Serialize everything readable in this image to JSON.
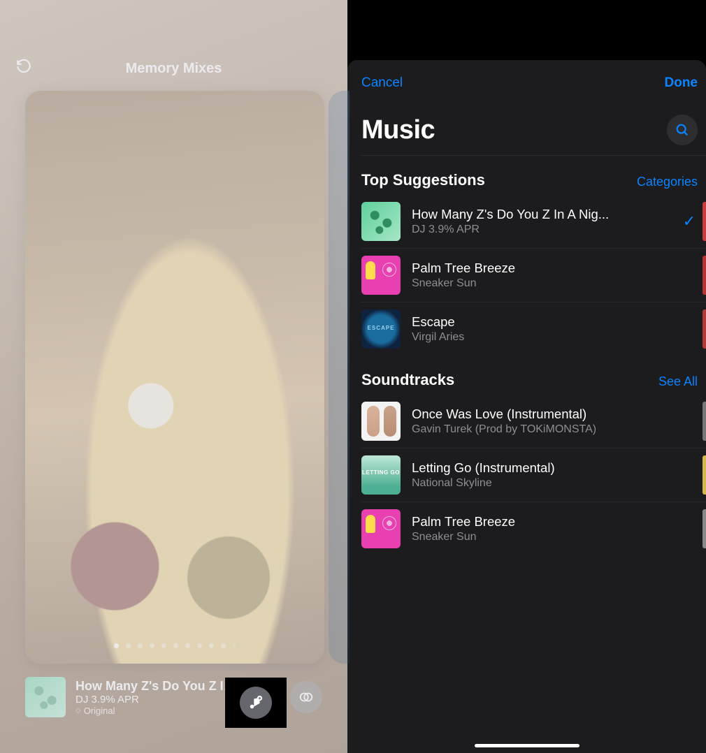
{
  "left": {
    "header_title": "Memory Mixes",
    "now_playing": {
      "title": "How Many Z's Do You Z In...",
      "artist": "DJ 3.9% APR",
      "source": "Original"
    }
  },
  "right": {
    "cancel": "Cancel",
    "done": "Done",
    "title": "Music",
    "sections": {
      "top": {
        "title": "Top Suggestions",
        "link": "Categories",
        "tracks": [
          {
            "title": "How Many Z's Do You Z In A Nig...",
            "artist": "DJ 3.9% APR",
            "selected": true
          },
          {
            "title": "Palm Tree Breeze",
            "artist": "Sneaker Sun",
            "selected": false
          },
          {
            "title": "Escape",
            "artist": "Virgil Aries",
            "selected": false
          }
        ]
      },
      "soundtracks": {
        "title": "Soundtracks",
        "link": "See All",
        "tracks": [
          {
            "title": "Once Was Love (Instrumental)",
            "artist": "Gavin Turek (Prod by TOKiMONSTA)"
          },
          {
            "title": "Letting Go (Instrumental)",
            "artist": "National Skyline"
          },
          {
            "title": "Palm Tree Breeze",
            "artist": "Sneaker Sun"
          }
        ]
      }
    }
  }
}
